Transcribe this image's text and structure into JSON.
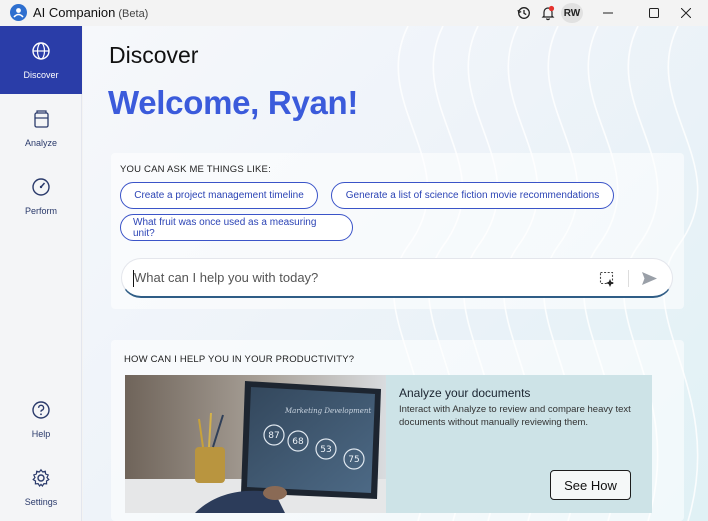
{
  "window": {
    "app_title": "AI Companion",
    "beta_label": "(Beta)",
    "avatar_initials": "RW",
    "icons": [
      "history-icon",
      "bell-icon",
      "minimize-icon",
      "maximize-icon",
      "close-icon"
    ]
  },
  "sidebar": {
    "items": [
      {
        "label": "Discover",
        "icon": "globe-icon",
        "active": true
      },
      {
        "label": "Analyze",
        "icon": "document-stack-icon",
        "active": false
      },
      {
        "label": "Perform",
        "icon": "gauge-icon",
        "active": false
      },
      {
        "label": "Help",
        "icon": "help-icon",
        "active": false
      },
      {
        "label": "Settings",
        "icon": "gear-icon",
        "active": false
      }
    ]
  },
  "main": {
    "page_title": "Discover",
    "welcome": "Welcome, Ryan!",
    "ask": {
      "heading": "YOU CAN ASK ME THINGS LIKE:",
      "suggestions": [
        "Create a project management timeline",
        "Generate a list of science fiction movie recommendations",
        "What fruit was once used as a measuring unit?"
      ],
      "input_placeholder": "What can I help you with today?"
    },
    "productivity": {
      "heading": "HOW CAN I HELP YOU IN YOUR PRODUCTIVITY?",
      "feature_title": "Analyze your documents",
      "feature_desc": "Interact with Analyze to review and compare heavy text documents without manually reviewing them.",
      "cta_label": "See How",
      "image_caption": "Marketing Development",
      "image_numbers": [
        "87",
        "68",
        "53",
        "75"
      ]
    }
  },
  "colors": {
    "accent": "#3b5bdb",
    "sidebar_active": "#2a3da8",
    "notification_dot": "#e5322d",
    "feature_panel": "#cde3e7"
  }
}
